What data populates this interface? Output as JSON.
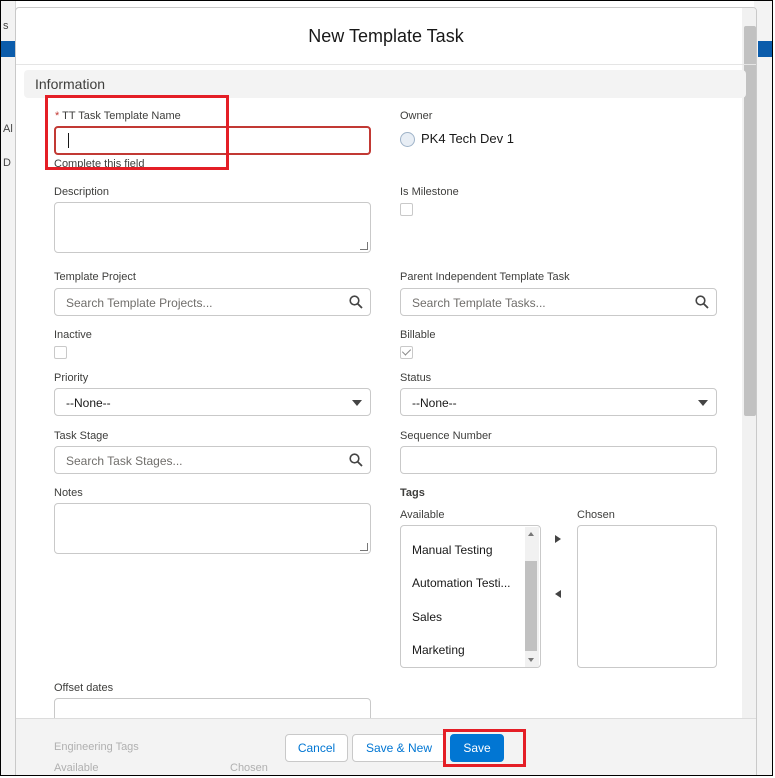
{
  "modal": {
    "title": "New Template Task"
  },
  "background": {
    "left_marks": [
      "s",
      "Al",
      "D"
    ]
  },
  "section": {
    "title": "Information"
  },
  "fields": {
    "task_name": {
      "required_marker": "*",
      "label": "TT Task Template Name",
      "value": "",
      "error": "Complete this field"
    },
    "owner": {
      "label": "Owner",
      "value": "PK4 Tech Dev 1"
    },
    "description": {
      "label": "Description"
    },
    "is_milestone": {
      "label": "Is Milestone",
      "checked": false
    },
    "template_project": {
      "label": "Template Project",
      "placeholder": "Search Template Projects..."
    },
    "parent_task": {
      "label": "Parent Independent Template Task",
      "placeholder": "Search Template Tasks..."
    },
    "inactive": {
      "label": "Inactive",
      "checked": false
    },
    "billable": {
      "label": "Billable",
      "checked": true
    },
    "priority": {
      "label": "Priority",
      "value": "--None--"
    },
    "status": {
      "label": "Status",
      "value": "--None--"
    },
    "task_stage": {
      "label": "Task Stage",
      "placeholder": "Search Task Stages..."
    },
    "sequence_number": {
      "label": "Sequence Number",
      "value": ""
    },
    "notes": {
      "label": "Notes"
    },
    "offset_dates": {
      "label": "Offset dates"
    }
  },
  "tags": {
    "label": "Tags",
    "available_label": "Available",
    "chosen_label": "Chosen",
    "available_items": [
      "Manual Testing",
      "Automation Testi...",
      "Sales",
      "Marketing"
    ],
    "chosen_items": []
  },
  "ghost": {
    "engineering_tags": "Engineering Tags",
    "available": "Available",
    "chosen": "Chosen"
  },
  "footer": {
    "cancel_label": "Cancel",
    "save_new_label": "Save & New",
    "save_label": "Save"
  },
  "colors": {
    "brand": "#0176d3",
    "error": "#c23934",
    "highlight": "#e41e26"
  }
}
